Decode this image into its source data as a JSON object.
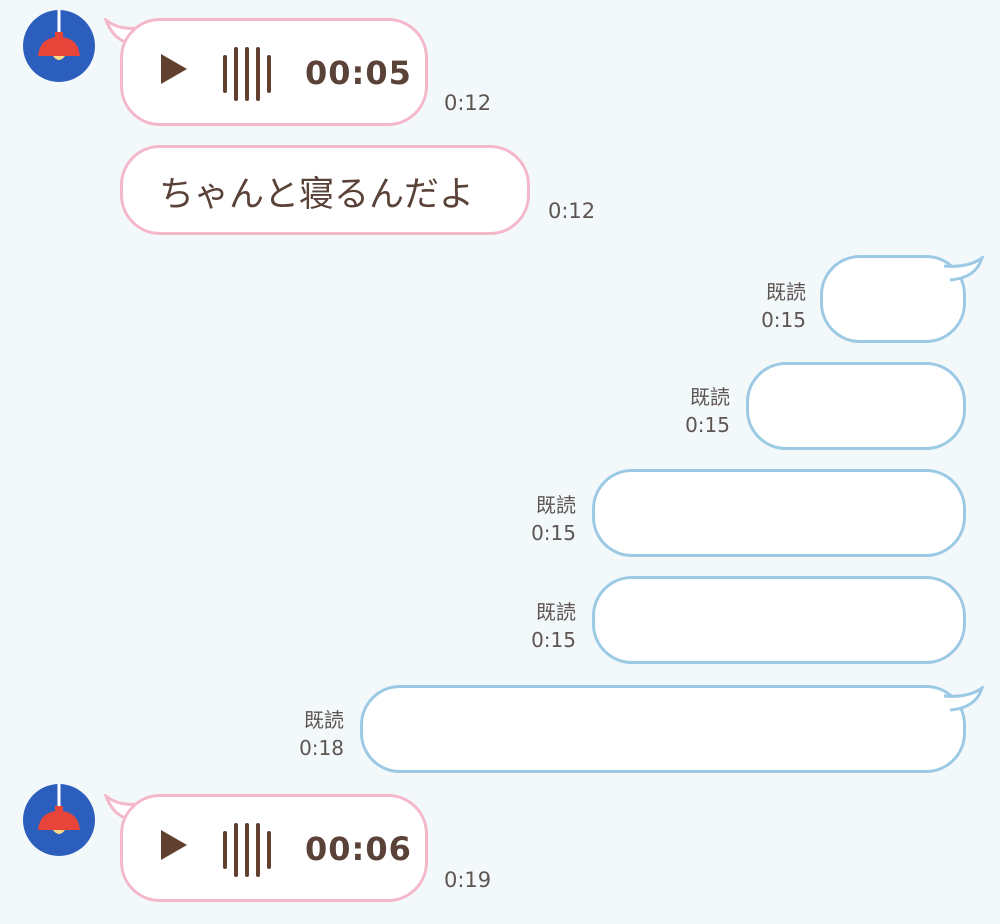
{
  "messages": [
    {
      "kind": "voice",
      "side": "left",
      "duration": "00:05",
      "time": "0:12",
      "avatar_icon": "lamp-icon"
    },
    {
      "kind": "text",
      "side": "left",
      "text": "ちゃんと寝るんだよ",
      "time": "0:12"
    },
    {
      "kind": "text",
      "side": "right",
      "text": "",
      "read_label": "既読",
      "time": "0:15"
    },
    {
      "kind": "text",
      "side": "right",
      "text": "",
      "read_label": "既読",
      "time": "0:15"
    },
    {
      "kind": "text",
      "side": "right",
      "text": "",
      "read_label": "既読",
      "time": "0:15"
    },
    {
      "kind": "text",
      "side": "right",
      "text": "",
      "read_label": "既読",
      "time": "0:15"
    },
    {
      "kind": "text",
      "side": "right",
      "text": "",
      "read_label": "既読",
      "time": "0:18"
    },
    {
      "kind": "voice",
      "side": "left",
      "duration": "00:06",
      "time": "0:19",
      "avatar_icon": "lamp-icon"
    }
  ],
  "colors": {
    "background": "#f3f8fb",
    "incoming_border": "#f4b8cb",
    "outgoing_border": "#9cc9e4",
    "avatar_bg": "#2c5fbd",
    "lamp": "#e8453a",
    "text": "#5a4238"
  }
}
